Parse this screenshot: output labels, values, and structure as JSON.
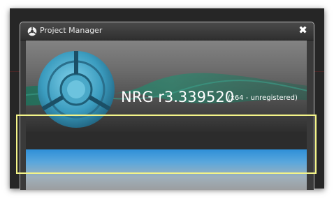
{
  "window": {
    "title": "Project Manager",
    "close_glyph": "✖"
  },
  "splash": {
    "product_name": "NRG r3.339520",
    "edition": "(x64 - unregistered)"
  },
  "progress": {
    "fill_fraction": 1.0
  },
  "colors": {
    "accent_blue": "#2e8fd8",
    "highlight": "#f4f488"
  },
  "icons": [
    "app-icon",
    "close-icon",
    "logo-icon"
  ]
}
